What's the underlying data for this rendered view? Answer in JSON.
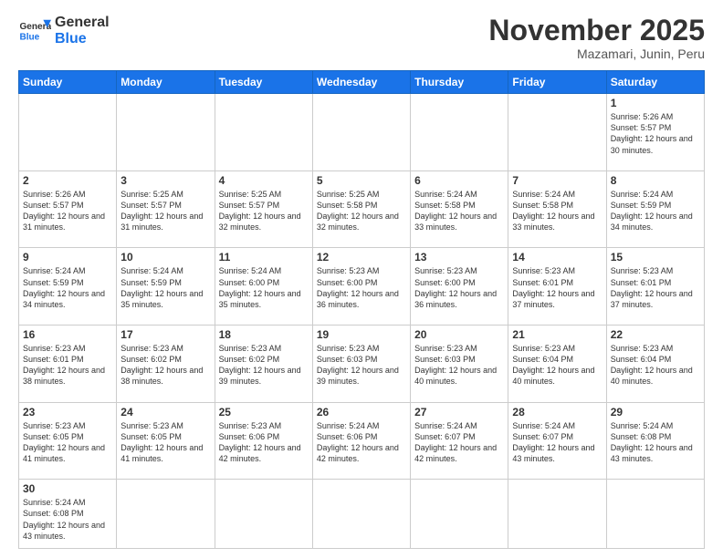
{
  "header": {
    "logo_general": "General",
    "logo_blue": "Blue",
    "month_year": "November 2025",
    "location": "Mazamari, Junin, Peru"
  },
  "weekdays": [
    "Sunday",
    "Monday",
    "Tuesday",
    "Wednesday",
    "Thursday",
    "Friday",
    "Saturday"
  ],
  "weeks": [
    [
      {
        "day": "",
        "info": ""
      },
      {
        "day": "",
        "info": ""
      },
      {
        "day": "",
        "info": ""
      },
      {
        "day": "",
        "info": ""
      },
      {
        "day": "",
        "info": ""
      },
      {
        "day": "",
        "info": ""
      },
      {
        "day": "1",
        "info": "Sunrise: 5:26 AM\nSunset: 5:57 PM\nDaylight: 12 hours and 30 minutes."
      }
    ],
    [
      {
        "day": "2",
        "info": "Sunrise: 5:26 AM\nSunset: 5:57 PM\nDaylight: 12 hours and 31 minutes."
      },
      {
        "day": "3",
        "info": "Sunrise: 5:25 AM\nSunset: 5:57 PM\nDaylight: 12 hours and 31 minutes."
      },
      {
        "day": "4",
        "info": "Sunrise: 5:25 AM\nSunset: 5:57 PM\nDaylight: 12 hours and 32 minutes."
      },
      {
        "day": "5",
        "info": "Sunrise: 5:25 AM\nSunset: 5:58 PM\nDaylight: 12 hours and 32 minutes."
      },
      {
        "day": "6",
        "info": "Sunrise: 5:24 AM\nSunset: 5:58 PM\nDaylight: 12 hours and 33 minutes."
      },
      {
        "day": "7",
        "info": "Sunrise: 5:24 AM\nSunset: 5:58 PM\nDaylight: 12 hours and 33 minutes."
      },
      {
        "day": "8",
        "info": "Sunrise: 5:24 AM\nSunset: 5:59 PM\nDaylight: 12 hours and 34 minutes."
      }
    ],
    [
      {
        "day": "9",
        "info": "Sunrise: 5:24 AM\nSunset: 5:59 PM\nDaylight: 12 hours and 34 minutes."
      },
      {
        "day": "10",
        "info": "Sunrise: 5:24 AM\nSunset: 5:59 PM\nDaylight: 12 hours and 35 minutes."
      },
      {
        "day": "11",
        "info": "Sunrise: 5:24 AM\nSunset: 6:00 PM\nDaylight: 12 hours and 35 minutes."
      },
      {
        "day": "12",
        "info": "Sunrise: 5:23 AM\nSunset: 6:00 PM\nDaylight: 12 hours and 36 minutes."
      },
      {
        "day": "13",
        "info": "Sunrise: 5:23 AM\nSunset: 6:00 PM\nDaylight: 12 hours and 36 minutes."
      },
      {
        "day": "14",
        "info": "Sunrise: 5:23 AM\nSunset: 6:01 PM\nDaylight: 12 hours and 37 minutes."
      },
      {
        "day": "15",
        "info": "Sunrise: 5:23 AM\nSunset: 6:01 PM\nDaylight: 12 hours and 37 minutes."
      }
    ],
    [
      {
        "day": "16",
        "info": "Sunrise: 5:23 AM\nSunset: 6:01 PM\nDaylight: 12 hours and 38 minutes."
      },
      {
        "day": "17",
        "info": "Sunrise: 5:23 AM\nSunset: 6:02 PM\nDaylight: 12 hours and 38 minutes."
      },
      {
        "day": "18",
        "info": "Sunrise: 5:23 AM\nSunset: 6:02 PM\nDaylight: 12 hours and 39 minutes."
      },
      {
        "day": "19",
        "info": "Sunrise: 5:23 AM\nSunset: 6:03 PM\nDaylight: 12 hours and 39 minutes."
      },
      {
        "day": "20",
        "info": "Sunrise: 5:23 AM\nSunset: 6:03 PM\nDaylight: 12 hours and 40 minutes."
      },
      {
        "day": "21",
        "info": "Sunrise: 5:23 AM\nSunset: 6:04 PM\nDaylight: 12 hours and 40 minutes."
      },
      {
        "day": "22",
        "info": "Sunrise: 5:23 AM\nSunset: 6:04 PM\nDaylight: 12 hours and 40 minutes."
      }
    ],
    [
      {
        "day": "23",
        "info": "Sunrise: 5:23 AM\nSunset: 6:05 PM\nDaylight: 12 hours and 41 minutes."
      },
      {
        "day": "24",
        "info": "Sunrise: 5:23 AM\nSunset: 6:05 PM\nDaylight: 12 hours and 41 minutes."
      },
      {
        "day": "25",
        "info": "Sunrise: 5:23 AM\nSunset: 6:06 PM\nDaylight: 12 hours and 42 minutes."
      },
      {
        "day": "26",
        "info": "Sunrise: 5:24 AM\nSunset: 6:06 PM\nDaylight: 12 hours and 42 minutes."
      },
      {
        "day": "27",
        "info": "Sunrise: 5:24 AM\nSunset: 6:07 PM\nDaylight: 12 hours and 42 minutes."
      },
      {
        "day": "28",
        "info": "Sunrise: 5:24 AM\nSunset: 6:07 PM\nDaylight: 12 hours and 43 minutes."
      },
      {
        "day": "29",
        "info": "Sunrise: 5:24 AM\nSunset: 6:08 PM\nDaylight: 12 hours and 43 minutes."
      }
    ],
    [
      {
        "day": "30",
        "info": "Sunrise: 5:24 AM\nSunset: 6:08 PM\nDaylight: 12 hours and 43 minutes."
      },
      {
        "day": "",
        "info": ""
      },
      {
        "day": "",
        "info": ""
      },
      {
        "day": "",
        "info": ""
      },
      {
        "day": "",
        "info": ""
      },
      {
        "day": "",
        "info": ""
      },
      {
        "day": "",
        "info": ""
      }
    ]
  ]
}
